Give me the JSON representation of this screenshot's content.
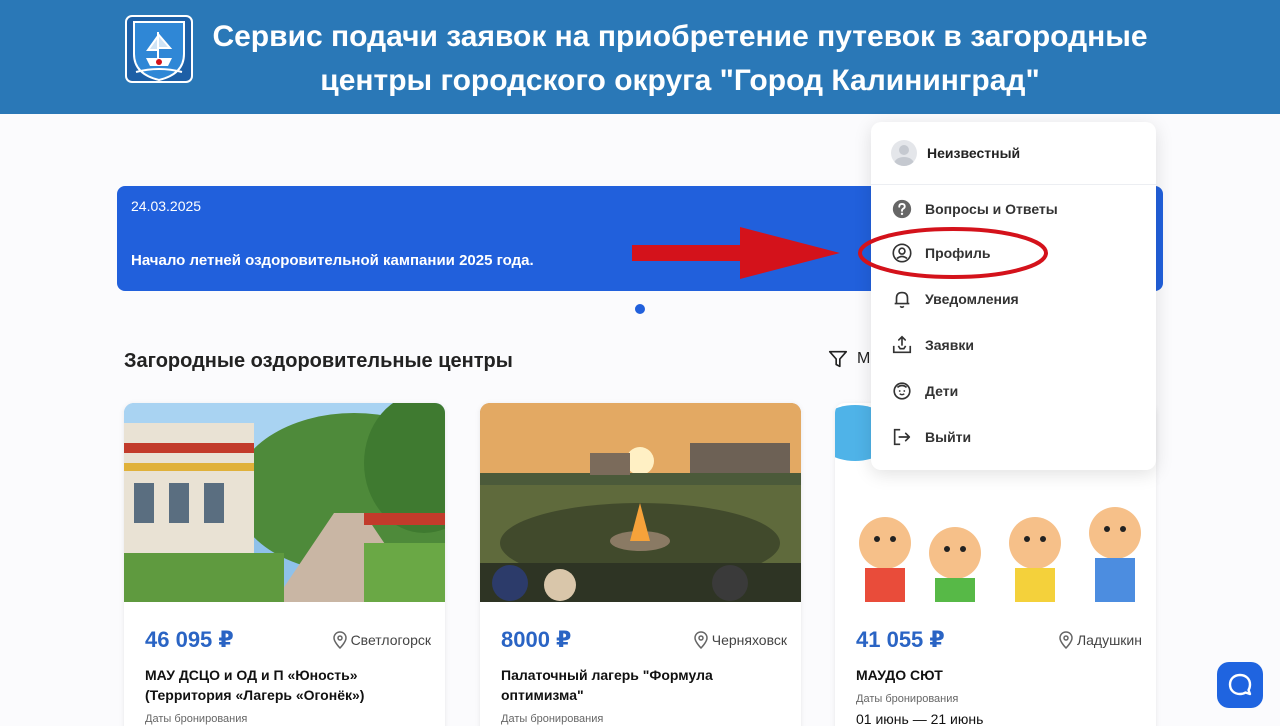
{
  "header": {
    "title_line1": "Сервис подачи заявок на приобретение путевок в загородные",
    "title_line2": "центры городского округа \"Город Калининград\""
  },
  "banner": {
    "date": "24.03.2025",
    "text": "Начало летней оздоровительной кампании 2025 года."
  },
  "section": {
    "title": "Загородные оздоровительные центры",
    "filter_label": "М"
  },
  "cards": [
    {
      "price": "46 095 ₽",
      "location": "Светлогорск",
      "name": "МАУ ДСЦО и ОД и П «Юность» (Территория «Лагерь «Огонёк»)",
      "dates_label": "Даты бронирования",
      "dates": ""
    },
    {
      "price": "8000 ₽",
      "location": "Черняховск",
      "name": "Палаточный лагерь \"Формула оптимизма\"",
      "dates_label": "Даты бронирования",
      "dates": ""
    },
    {
      "price": "41 055 ₽",
      "location": "Ладушкин",
      "name": "МАУДО СЮТ",
      "dates_label": "Даты бронирования",
      "dates": "01 июнь — 21 июнь"
    }
  ],
  "menu": {
    "user_name": "Неизвестный",
    "items": [
      {
        "label": "Вопросы и Ответы",
        "icon": "question-icon"
      },
      {
        "label": "Профиль",
        "icon": "profile-icon"
      },
      {
        "label": "Уведомления",
        "icon": "bell-icon"
      },
      {
        "label": "Заявки",
        "icon": "inbox-icon"
      },
      {
        "label": "Дети",
        "icon": "child-icon"
      },
      {
        "label": "Выйти",
        "icon": "logout-icon"
      }
    ]
  },
  "colors": {
    "header": "#2a78b7",
    "banner": "#2160dc",
    "price": "#2a64c4",
    "highlight": "#d4121b"
  }
}
